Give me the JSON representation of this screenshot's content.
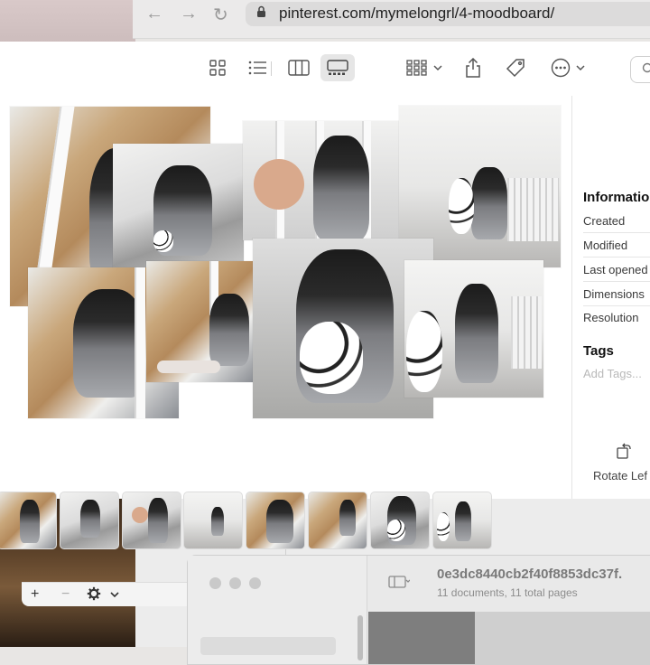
{
  "browser": {
    "url": "pinterest.com/mymelongrl/4-moodboard/",
    "nav": {
      "back_icon": "back-arrow-icon",
      "forward_icon": "forward-arrow-icon",
      "reload_icon": "reload-icon",
      "lock_icon": "lock-icon"
    }
  },
  "toolbar": {
    "buttons": [
      {
        "name": "icon-view-button",
        "icon": "grid-icon"
      },
      {
        "name": "list-view-button",
        "icon": "list-icon"
      },
      {
        "name": "column-view-button",
        "icon": "columns-icon"
      },
      {
        "name": "gallery-view-button",
        "icon": "gallery-icon",
        "selected": true
      },
      {
        "name": "group-button",
        "icon": "group-icon"
      },
      {
        "name": "share-button",
        "icon": "share-icon"
      },
      {
        "name": "tag-button",
        "icon": "tag-icon"
      },
      {
        "name": "more-button",
        "icon": "ellipsis-icon"
      }
    ]
  },
  "inspector": {
    "heading": "Informatio",
    "rows": [
      "Created",
      "Modified",
      "Last opened",
      "Dimensions",
      "Resolution"
    ],
    "tags_heading": "Tags",
    "add_tags_placeholder": "Add Tags...",
    "rotate_label": "Rotate Lef"
  },
  "filmstrip": {
    "count": 8
  },
  "small_toolbar": {
    "add_label": "+",
    "remove_label": "−",
    "gear_icon": "gear-icon",
    "chevron_icon": "chevron-down-icon"
  },
  "preview_window": {
    "title": "0e3dc8440cb2f40f8853dc37f.",
    "subtitle": "11 documents, 11 total pages"
  },
  "colors": {
    "accent_selected_bg": "#e6e6e6",
    "text_primary": "#111111",
    "text_secondary": "#3a3a3a",
    "placeholder": "#b9b9b9"
  }
}
